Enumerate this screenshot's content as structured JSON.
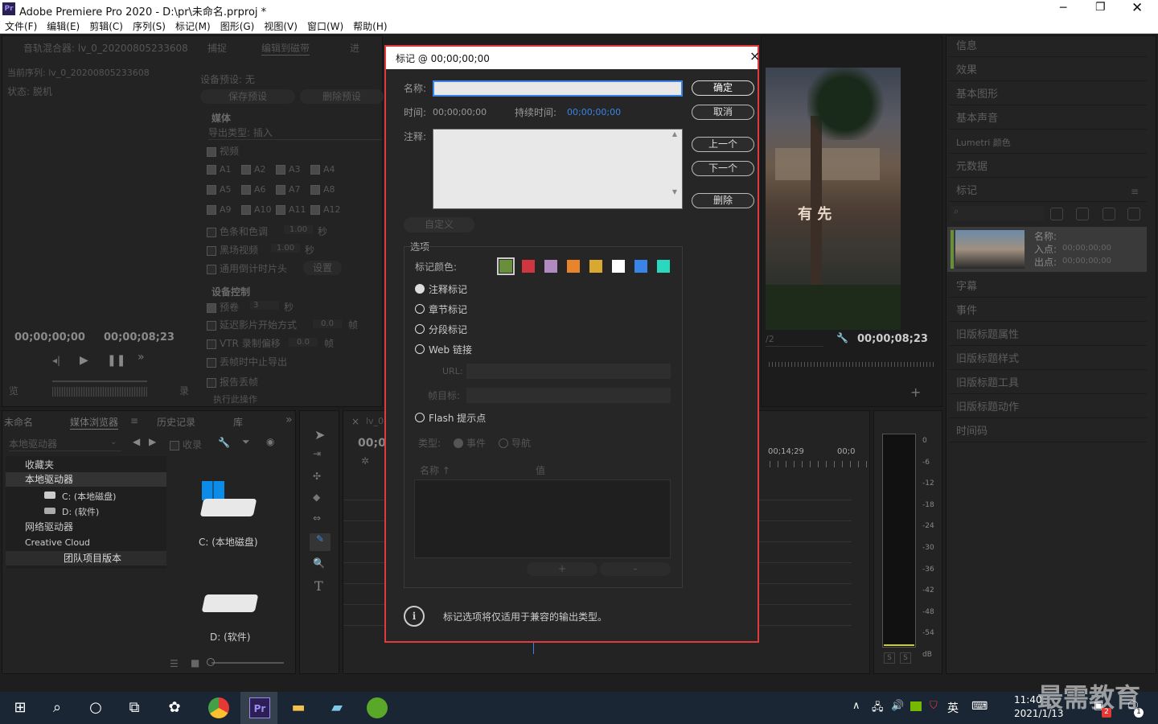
{
  "window": {
    "title": "Adobe Premiere Pro 2020 - D:\\pr\\未命名.prproj *",
    "app_icon": "Pr"
  },
  "menu": [
    "文件(F)",
    "编辑(E)",
    "剪辑(C)",
    "序列(S)",
    "标记(M)",
    "图形(G)",
    "视图(V)",
    "窗口(W)",
    "帮助(H)"
  ],
  "left_panel": {
    "tabs": [
      "音轨混合器: lv_0_20200805233608",
      "捕捉",
      "编辑到磁带",
      "进"
    ],
    "current_sequence": "当前序列: lv_0_20200805233608",
    "status": "状态: 脱机",
    "device_preset": "设备预设: 无",
    "save_preset": "保存预设",
    "delete_preset": "删除预设",
    "media_header": "媒体",
    "export_type": "导出类型: 插入",
    "video": "视频",
    "audio_tracks": [
      "A1",
      "A2",
      "A3",
      "A4",
      "A5",
      "A6",
      "A7",
      "A8",
      "A9",
      "A10",
      "A11",
      "A12"
    ],
    "color_bars": "色条和色调",
    "black_video": "黑场视频",
    "countdown": "通用倒计时片头",
    "settings_btn": "设置",
    "seconds": "秒",
    "val_100": "1.00",
    "device_control": "设备控制",
    "preroll": "预卷",
    "preroll_val": "3",
    "delay_start": "延迟影片开始方式",
    "frame_unit": "帧",
    "vtr_offset": "VTR 录制偏移",
    "val_00": "0.0",
    "abort_drop": "丢帧时中止导出",
    "report_drop": "报告丢帧",
    "tc_left": "00;00;00;00",
    "tc_mid": "00;00;08;23",
    "record_btn": "录",
    "cut_btn": "览",
    "render_btn": "执行此操作"
  },
  "media_browser": {
    "tabs": [
      "未命名",
      "媒体浏览器",
      "历史记录",
      "库"
    ],
    "location": "本地驱动器",
    "collect": "收录",
    "tree": [
      "收藏夹",
      "本地驱动器",
      "C: (本地磁盘)",
      "D: (软件)",
      "网络驱动器",
      "Creative Cloud",
      "团队项目版本"
    ],
    "drives": [
      "C: (本地磁盘)",
      "D: (软件)"
    ]
  },
  "program_monitor": {
    "timecode": "00;00;08;23",
    "sign_text": "有  先",
    "fraction": "/2"
  },
  "timeline": {
    "tc": "00;00",
    "marks": [
      "00;14;29",
      "00;0"
    ],
    "tab_close": "×",
    "tab_label": "lv_0"
  },
  "audio_meter": {
    "labels": [
      "0",
      "-6",
      "-12",
      "-18",
      "-24",
      "-30",
      "-36",
      "-42",
      "-48",
      "-54",
      "dB"
    ],
    "solo": "S"
  },
  "right_panel": {
    "items": [
      "信息",
      "效果",
      "基本图形",
      "基本声音",
      "Lumetri 颜色",
      "元数据",
      "标记",
      "字幕",
      "事件",
      "旧版标题属性",
      "旧版标题样式",
      "旧版标题工具",
      "旧版标题动作",
      "时间码"
    ],
    "marker_entry": {
      "name_label": "名称:",
      "in_label": "入点:",
      "out_label": "出点:",
      "in_val": "00;00;00;00",
      "out_val": "00;00;00;00"
    }
  },
  "dialog": {
    "title": "标记 @ 00;00;00;00",
    "name_label": "名称:",
    "name_value": "",
    "time_label": "时间:",
    "time_value": "00;00;00;00",
    "duration_label": "持续时间:",
    "duration_value": "00;00;00;00",
    "comment_label": "注释:",
    "ok": "确定",
    "cancel": "取消",
    "prev": "上一个",
    "next": "下一个",
    "delete": "删除",
    "custom": "自定义",
    "options_label": "选项",
    "marker_color_label": "标记颜色:",
    "colors": [
      "#6a8f3a",
      "#d03540",
      "#b38ac0",
      "#e8852a",
      "#d8a830",
      "#ffffff",
      "#3a84e8",
      "#2ad8c0"
    ],
    "types": [
      "注释标记",
      "章节标记",
      "分段标记",
      "Web 链接",
      "Flash 提示点"
    ],
    "url_label": "URL:",
    "frame_target_label": "帧目标:",
    "type_label": "类型:",
    "event": "事件",
    "nav": "导航",
    "col_name": "名称 ↑",
    "col_value": "值",
    "add": "+",
    "remove": "-",
    "info": "标记选项将仅适用于兼容的输出类型。",
    "close": "×"
  },
  "taskbar": {
    "time": "11:40",
    "date": "2021/1/13",
    "ime": "英",
    "watermark": "最需教育",
    "badge1": "2",
    "badge2": "1"
  },
  "accent": "#e0393e"
}
